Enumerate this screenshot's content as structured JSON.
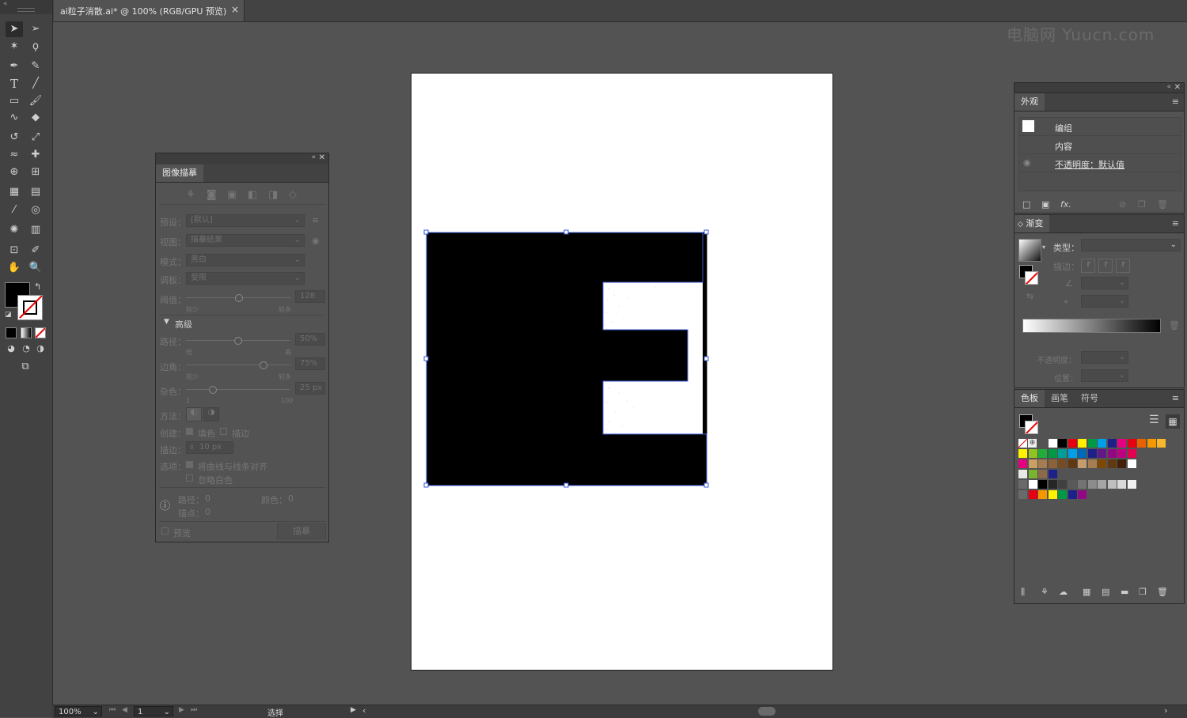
{
  "document_tab": {
    "title": "ai粒子消散.ai* @ 100% (RGB/GPU 预览)",
    "close": "×"
  },
  "watermark": "电脑网 Yuucn.com",
  "image_trace": {
    "title": "图像描摹",
    "preset_label": "预设：",
    "preset_value": "[默认]",
    "view_label": "视图：",
    "view_value": "描摹结果",
    "mode_label": "模式：",
    "mode_value": "黑白",
    "palette_label": "调板：",
    "palette_value": "受限",
    "threshold_label": "阈值：",
    "threshold_value": "128",
    "threshold_min": "较少",
    "threshold_max": "较多",
    "advanced_label": "高级",
    "paths_label": "路径：",
    "paths_value": "50%",
    "paths_min": "低",
    "paths_max": "高",
    "corners_label": "边角：",
    "corners_value": "75%",
    "corners_min": "较少",
    "corners_max": "较多",
    "noise_label": "杂色：",
    "noise_value": "25 px",
    "noise_min": "1",
    "noise_max": "100",
    "method_label": "方法：",
    "create_label": "创建：",
    "fill_label": "填色",
    "stroke_label": "描边",
    "stroke_width_label": "描边：",
    "stroke_width_value": "10 px",
    "options_label": "选项：",
    "snap_label": "将曲线与线条对齐",
    "ignore_white_label": "忽略白色",
    "paths_count_label": "路径：",
    "paths_count": "0",
    "colors_count_label": "颜色：",
    "colors_count": "0",
    "anchors_count_label": "锚点：",
    "anchors_count": "0",
    "preview_label": "预览",
    "trace_button": "描摹"
  },
  "appearance": {
    "tab": "外观",
    "rows": [
      {
        "label": "编组"
      },
      {
        "label": "内容"
      },
      {
        "label": "不透明度：默认值"
      }
    ],
    "fx": "fx."
  },
  "gradient": {
    "tab": "渐变",
    "type_label": "类型：",
    "stroke_label": "描边：",
    "opacity_label": "不透明度：",
    "position_label": "位置："
  },
  "swatches": {
    "tabs": [
      "色板",
      "画笔",
      "符号"
    ],
    "colors": {
      "row1": [
        "#ffffff",
        "#000000",
        "#e60012",
        "#fff100",
        "#009944",
        "#00a0e9",
        "#1d2088",
        "#e4007f",
        "#e60012",
        "#eb6100",
        "#f39800",
        "#f8b62d"
      ],
      "row2": [
        "#fff100",
        "#8fc31f",
        "#22ac38",
        "#009944",
        "#009e96",
        "#00a0e9",
        "#0068b7",
        "#1d2088",
        "#601986",
        "#920783",
        "#be0081",
        "#e5004f"
      ],
      "row3": [
        "#e4007f",
        "#c9a063",
        "#a67c52",
        "#8c6239",
        "#754c24",
        "#603813",
        "#c69c6d",
        "#a67c52",
        "#7d4900",
        "#603913",
        "#42210b",
        "#ffffff"
      ],
      "row5": [
        "#ffffff",
        "#000000",
        "#262626",
        "#404040",
        "#595959",
        "#737373",
        "#8c8c8c",
        "#a6a6a6",
        "#bfbfbf",
        "#d9d9d9",
        "#f2f2f2"
      ],
      "row6": [
        "#e60012",
        "#f39800",
        "#fff100",
        "#009944",
        "#1d2088",
        "#920783"
      ]
    }
  },
  "status": {
    "zoom": "100%",
    "page": "1",
    "tool": "选择"
  }
}
